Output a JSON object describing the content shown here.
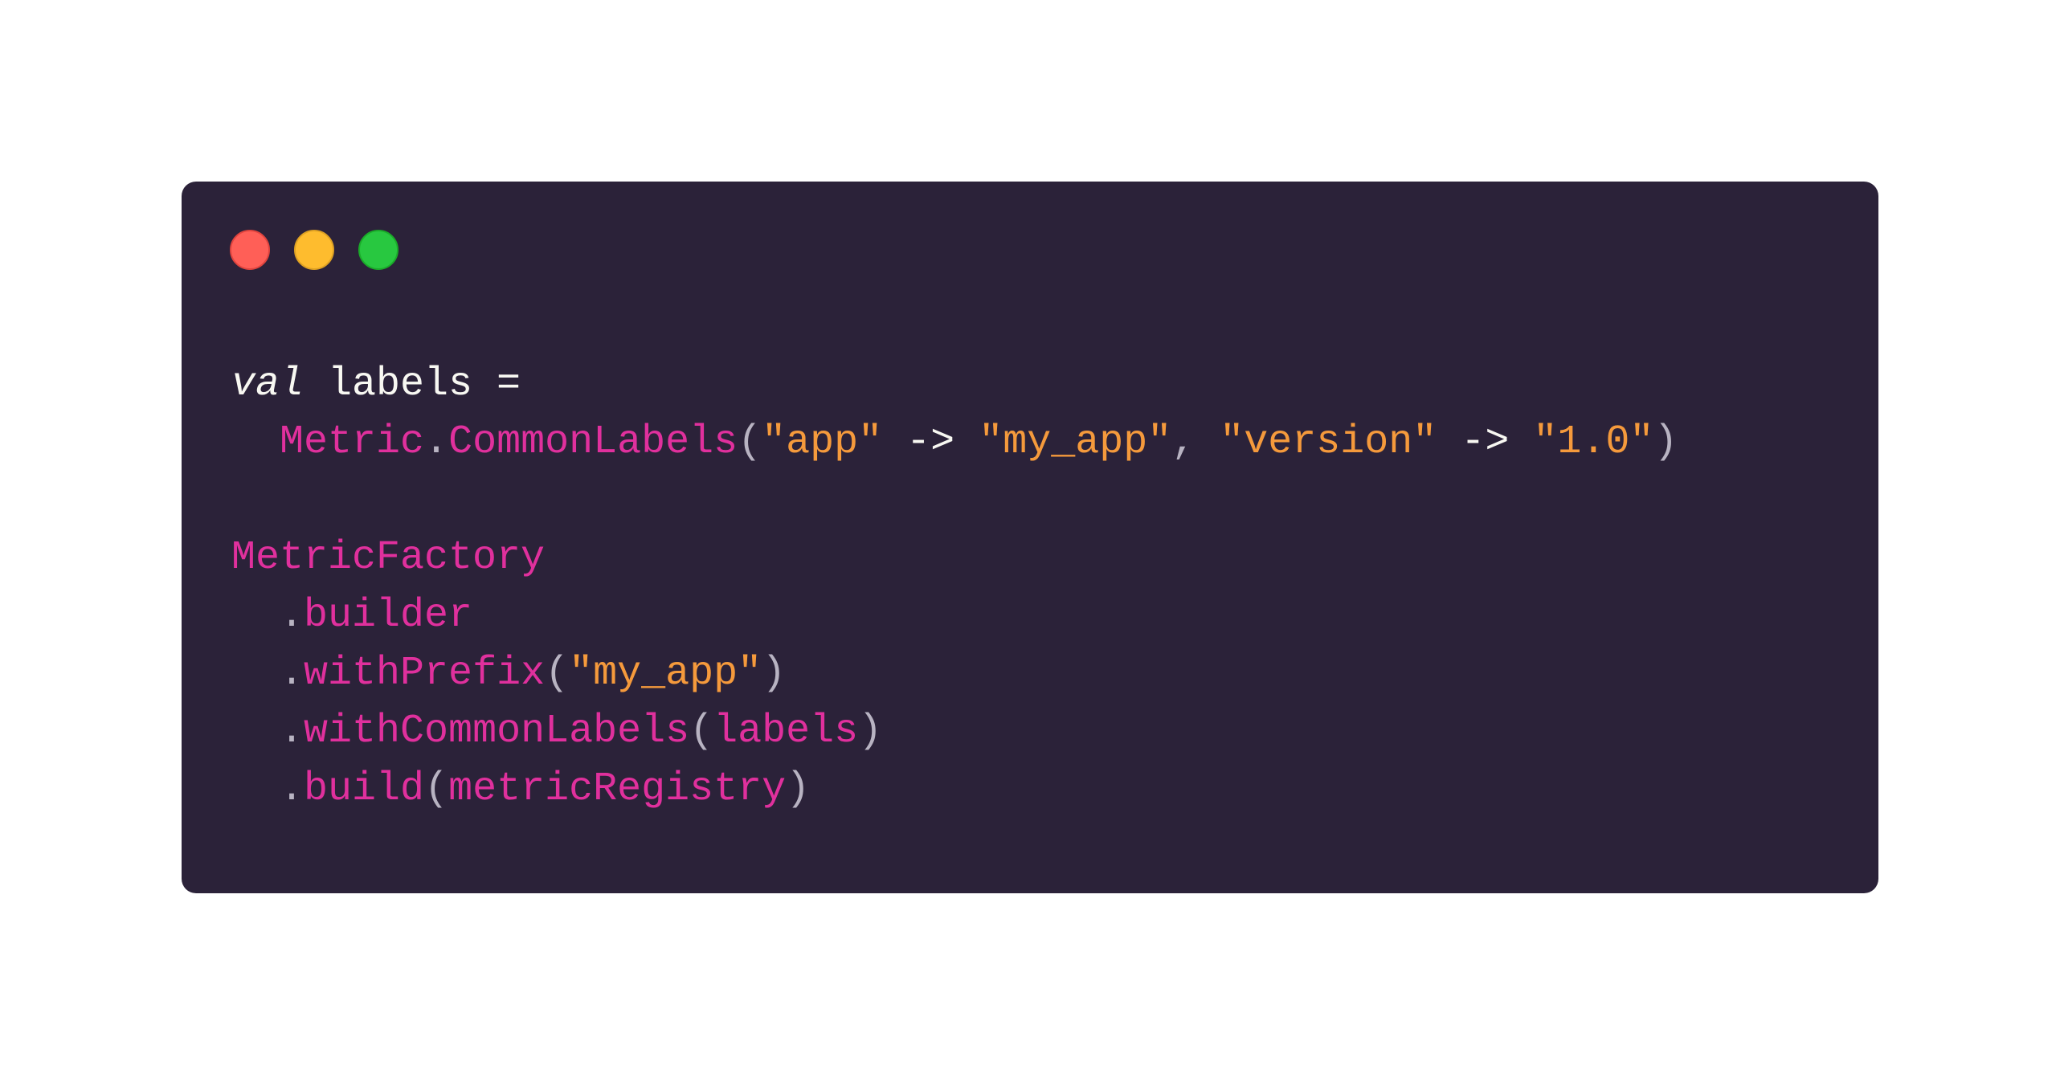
{
  "window": {
    "controls": [
      "close-dot",
      "minimize-dot",
      "maximize-dot"
    ],
    "colors": {
      "background": "#2b2239",
      "close": "#ff5f57",
      "minimize": "#febc2e",
      "maximize": "#28c840"
    }
  },
  "code": {
    "colors": {
      "keyword": "#f8f8f2",
      "identifier": "#e0309d",
      "string": "#f59a3c",
      "punctuation": "#b8b3c2"
    },
    "line1": {
      "kw": "val",
      "rest": " labels ="
    },
    "line2": {
      "indent": "  ",
      "obj": "Metric",
      "dot": ".",
      "fn": "CommonLabels",
      "lparen": "(",
      "s1": "\"app\"",
      "arrow1": " -> ",
      "s2": "\"my_app\"",
      "comma": ", ",
      "s3": "\"version\"",
      "arrow2": " -> ",
      "s4": "\"1.0\"",
      "rparen": ")"
    },
    "line4": {
      "obj": "MetricFactory"
    },
    "line5": {
      "indent": "  ",
      "dot": ".",
      "fn": "builder"
    },
    "line6": {
      "indent": "  ",
      "dot": ".",
      "fn": "withPrefix",
      "lparen": "(",
      "s1": "\"my_app\"",
      "rparen": ")"
    },
    "line7": {
      "indent": "  ",
      "dot": ".",
      "fn": "withCommonLabels",
      "lparen": "(",
      "arg": "labels",
      "rparen": ")"
    },
    "line8": {
      "indent": "  ",
      "dot": ".",
      "fn": "build",
      "lparen": "(",
      "arg": "metricRegistry",
      "rparen": ")"
    }
  }
}
